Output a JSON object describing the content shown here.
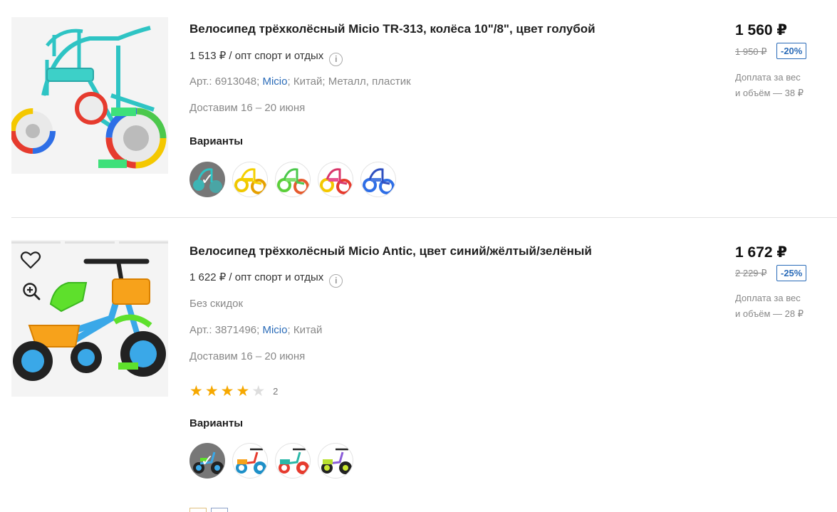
{
  "products": [
    {
      "title": "Велосипед трёхколёсный Micio TR-313, колёса 10\"/8\", цвет голубой",
      "wholesale": "1 513 ₽ / опт спорт и отдых",
      "article": "Арт.: 6913048;",
      "brand": "Micio",
      "country": "Китай;",
      "material": "Металл, пластик",
      "delivery": "Доставим 16 – 20 июня",
      "variants_label": "Варианты",
      "variant_colors": [
        "turquoise",
        "yellow",
        "green",
        "pink",
        "blue"
      ],
      "price": "1 560 ₽",
      "old_price": "1 950 ₽",
      "discount": "-20%",
      "surcharge_line1": "Доплата за вес",
      "surcharge_line2": "и объём — 38 ₽",
      "icons": [
        "info-icon",
        "check-icon"
      ]
    },
    {
      "title": "Велосипед трёхколёсный Micio Antic, цвет синий/жёлтый/зелёный",
      "wholesale": "1 622 ₽ / опт спорт и отдых",
      "no_discount": "Без скидок",
      "article": "Арт.: 3871496;",
      "brand": "Micio",
      "country": "Китай",
      "delivery": "Доставим 16 – 20 июня",
      "rating": 4,
      "rating_max": 5,
      "rating_count": "2",
      "variants_label": "Варианты",
      "variant_colors": [
        "blue-green",
        "orange-red",
        "red-teal",
        "purple-lime"
      ],
      "price": "1 672 ₽",
      "old_price": "2 229 ₽",
      "discount": "-25%",
      "surcharge_line1": "Доплата за вес",
      "surcharge_line2": "и объём — 28 ₽",
      "icons": [
        "heart-icon",
        "zoom-in-icon",
        "info-icon",
        "star-icon",
        "check-icon"
      ]
    }
  ],
  "colors": {
    "accent": "#2a6bb8",
    "star": "#f6a800",
    "discount_border": "#2a6bb8"
  }
}
